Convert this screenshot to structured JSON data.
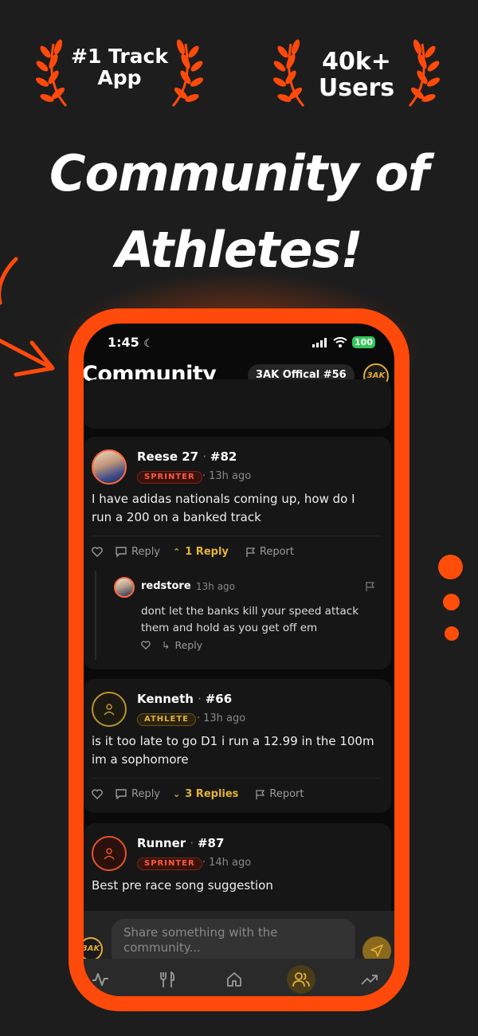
{
  "awards": [
    {
      "text": "#1 Track\nApp"
    },
    {
      "text": "40k+\nUsers"
    }
  ],
  "headline": {
    "line1": "Community of",
    "line2": "Athletes!"
  },
  "colors": {
    "accent": "#ff4a0b",
    "gold": "#e3b33a",
    "background": "#1d1d1d"
  },
  "status_bar": {
    "time": "1:45",
    "battery": "100"
  },
  "header": {
    "title": "Community",
    "user_chip": "3AK Offical #56",
    "logo": "3AK"
  },
  "posts": [
    {
      "author": "Reese 27",
      "number": "#82",
      "badge": "SPRINTER",
      "time": "13h ago",
      "text": "I have adidas nationals coming up, how do I run a 200 on a banked track",
      "actions": {
        "reply": "Reply",
        "replies": "1 Reply",
        "report": "Report"
      },
      "reply": {
        "author": "redstore",
        "time": "13h ago",
        "text": "dont let the banks kill your speed attack them and hold as you get off em",
        "reply_label": "Reply"
      }
    },
    {
      "author": "Kenneth",
      "number": "#66",
      "badge": "ATHLETE",
      "time": "13h ago",
      "text": "is it too late to go D1 i run a 12.99 in the 100m im a sophomore",
      "actions": {
        "reply": "Reply",
        "replies": "3 Replies",
        "report": "Report"
      }
    },
    {
      "author": "Runner",
      "number": "#87",
      "badge": "SPRINTER",
      "time": "14h ago",
      "text": "Best pre race song suggestion"
    }
  ],
  "composer": {
    "placeholder": "Share something with the community...",
    "logo": "3AK"
  },
  "tabbar": {
    "items": [
      {
        "icon": "activity-icon"
      },
      {
        "icon": "fork-knife-icon"
      },
      {
        "icon": "home-icon"
      },
      {
        "icon": "community-icon",
        "active": true
      },
      {
        "icon": "trending-icon"
      }
    ]
  }
}
